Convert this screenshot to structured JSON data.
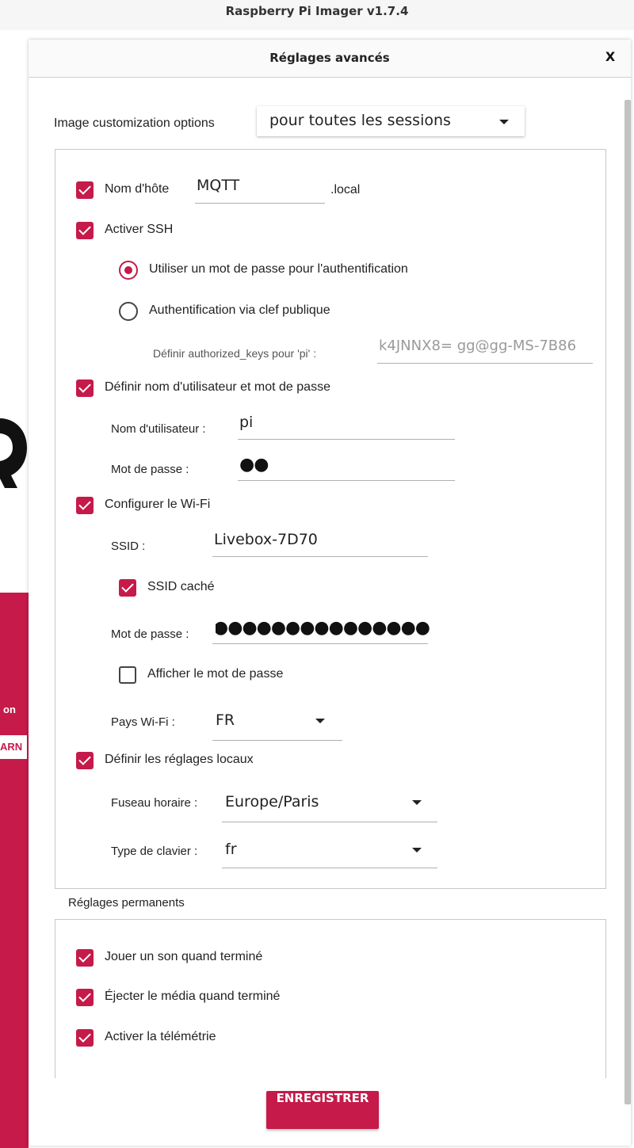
{
  "window": {
    "title": "Raspberry Pi Imager v1.7.4"
  },
  "background": {
    "stub_label": "on",
    "stub_button": "ARN"
  },
  "dialog": {
    "title": "Réglages avancés",
    "close_label": "X",
    "customization": {
      "label": "Image customization options",
      "value": "pour toutes les sessions"
    },
    "hostname": {
      "label": "Nom d'hôte",
      "value": "MQTT",
      "suffix": ".local",
      "checked": true
    },
    "ssh": {
      "label": "Activer SSH",
      "checked": true,
      "option_password": "Utiliser un mot de passe pour l'authentification",
      "option_pubkey": "Authentification via clef publique",
      "authorized_keys_label": "Définir authorized_keys pour 'pi' :",
      "authorized_keys_value": "k4JNNX8= gg@gg-MS-7B86"
    },
    "user": {
      "label": "Définir nom d'utilisateur et mot de passe",
      "checked": true,
      "username_label": "Nom d'utilisateur :",
      "username_value": "pi",
      "password_label": "Mot de passe :",
      "password_value": "●●"
    },
    "wifi": {
      "label": "Configurer le Wi-Fi",
      "checked": true,
      "ssid_label": "SSID :",
      "ssid_value": "Livebox-7D70",
      "hidden_label": "SSID caché",
      "hidden_checked": true,
      "password_label": "Mot de passe :",
      "password_value": "●●●●●●●●●●●●●●●●",
      "show_password_label": "Afficher le mot de passe",
      "show_password_checked": false,
      "country_label": "Pays Wi-Fi :",
      "country_value": "FR"
    },
    "locale": {
      "label": "Définir les réglages locaux",
      "checked": true,
      "timezone_label": "Fuseau horaire :",
      "timezone_value": "Europe/Paris",
      "keyboard_label": "Type de clavier :",
      "keyboard_value": "fr"
    },
    "permanent": {
      "title": "Réglages permanents",
      "items": [
        {
          "label": "Jouer un son quand terminé",
          "checked": true
        },
        {
          "label": "Éjecter le média quand terminé",
          "checked": true
        },
        {
          "label": "Activer la télémétrie",
          "checked": true
        }
      ]
    },
    "save_label": "ENREGISTRER"
  },
  "colors": {
    "accent": "#c51a4a"
  }
}
